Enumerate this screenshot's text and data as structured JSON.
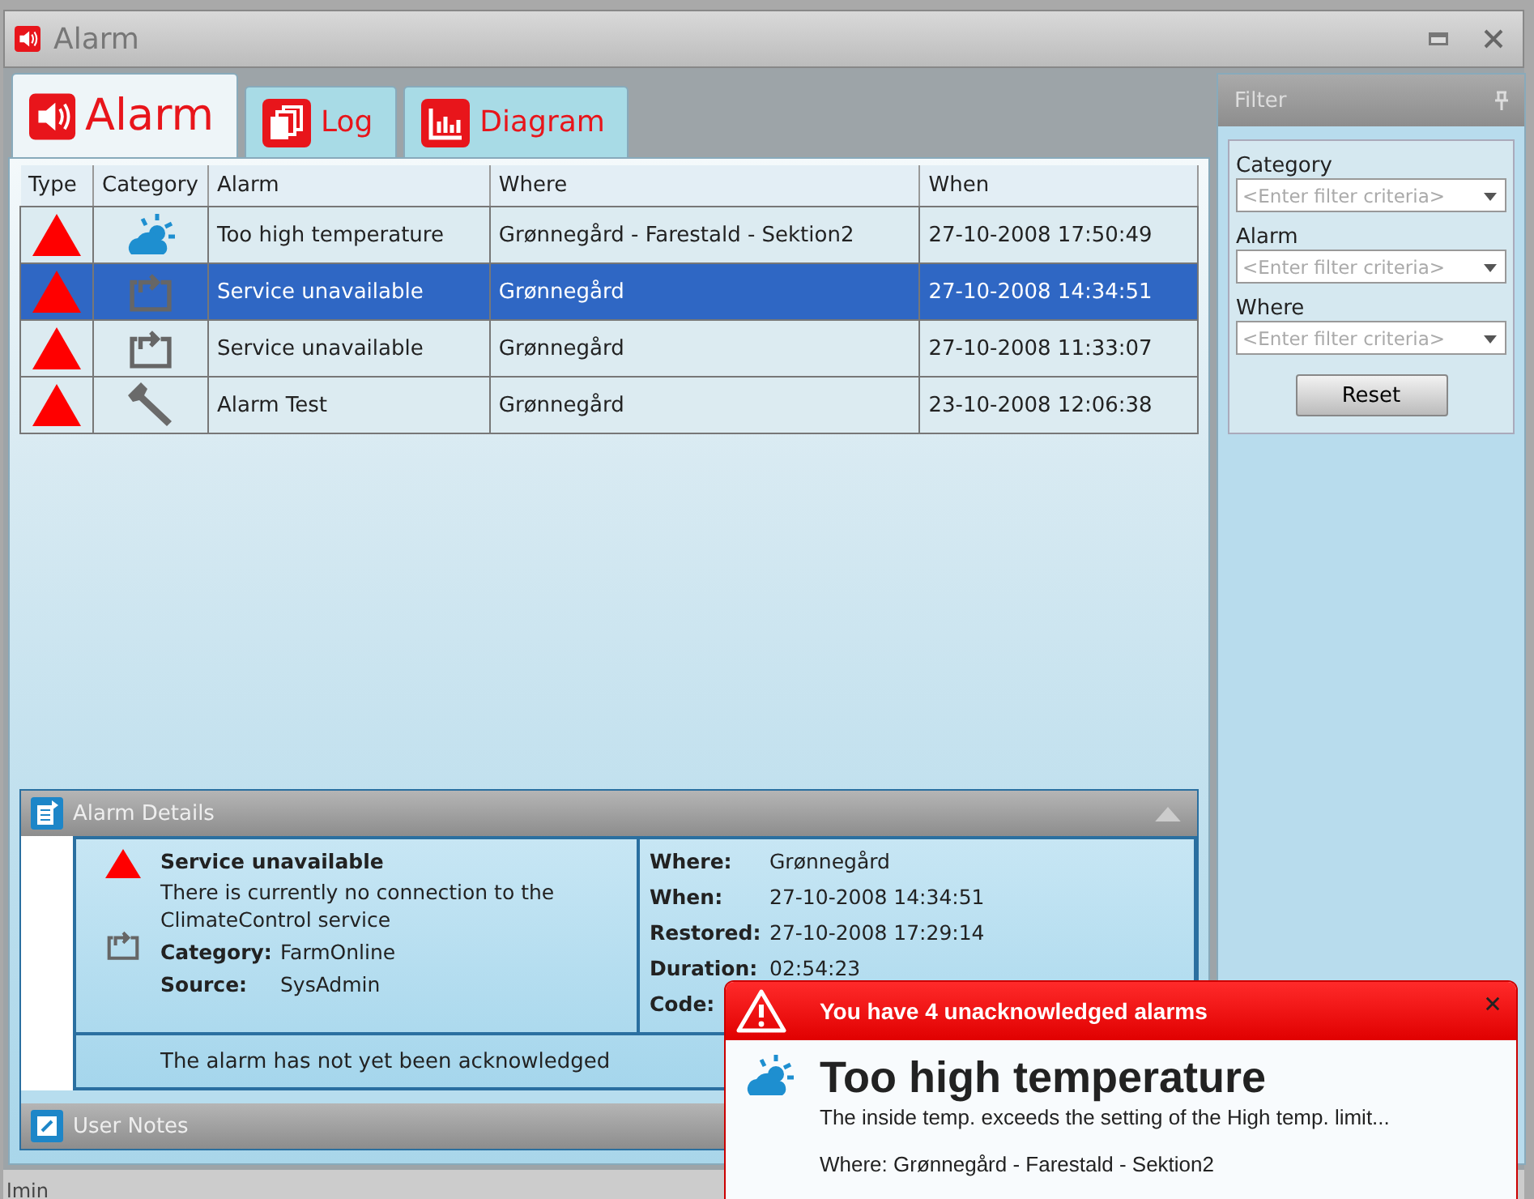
{
  "window": {
    "title": "Alarm"
  },
  "tabs": [
    {
      "label": "Alarm",
      "kind": "alarm",
      "selected": true
    },
    {
      "label": "Log",
      "kind": "log",
      "selected": false
    },
    {
      "label": "Diagram",
      "kind": "diagram",
      "selected": false
    }
  ],
  "table": {
    "columns": [
      "Type",
      "Category",
      "Alarm",
      "Where",
      "When"
    ],
    "rows": [
      {
        "kind": "weather",
        "alarm": "Too high temperature",
        "where": "Grønnegård - Farestald - Sektion2",
        "when": "27-10-2008 17:50:49",
        "selected": false
      },
      {
        "kind": "service",
        "alarm": "Service unavailable",
        "where": "Grønnegård",
        "when": "27-10-2008 14:34:51",
        "selected": true
      },
      {
        "kind": "service",
        "alarm": "Service unavailable",
        "where": "Grønnegård",
        "when": "27-10-2008 11:33:07",
        "selected": false
      },
      {
        "kind": "tool",
        "alarm": "Alarm Test",
        "where": "Grønnegård",
        "when": "23-10-2008 12:06:38",
        "selected": false
      }
    ]
  },
  "alarm_details": {
    "title": "Alarm Details",
    "expanded": true,
    "icon": {
      "kind": "service"
    },
    "alarm": "Service unavailable",
    "description": "There is currently no connection to the ClimateControl service",
    "fields_left": [
      {
        "label": "Category:",
        "value": "FarmOnline"
      },
      {
        "label": "Source:",
        "value": "SysAdmin"
      }
    ],
    "fields_right": [
      {
        "label": "Where:",
        "value": "Grønnegård"
      },
      {
        "label": "When:",
        "value": "27-10-2008 14:34:51"
      },
      {
        "label": "Restored:",
        "value": "27-10-2008 17:29:14"
      },
      {
        "label": "Duration:",
        "value": "02:54:23"
      },
      {
        "label": "Code:"
      }
    ],
    "acknowledgement": "The alarm has not yet been acknowledged"
  },
  "user_notes": {
    "title": "User Notes"
  },
  "filter": {
    "title": "Filter",
    "fields": [
      {
        "label": "Category",
        "placeholder": "<Enter filter criteria>"
      },
      {
        "label": "Alarm",
        "placeholder": "<Enter filter criteria>"
      },
      {
        "label": "Where",
        "placeholder": "<Enter filter criteria>"
      }
    ],
    "reset": "Reset"
  },
  "notification": {
    "header": "You have 4 unacknowledged alarms",
    "icon": {
      "kind": "weather"
    },
    "title": "Too high temperature",
    "message": "The inside temp. exceeds the setting of the High temp. limit...",
    "where": "Where: Grønnegård - Farestald - Sektion2"
  },
  "status_bar": {
    "text": "lmin"
  }
}
